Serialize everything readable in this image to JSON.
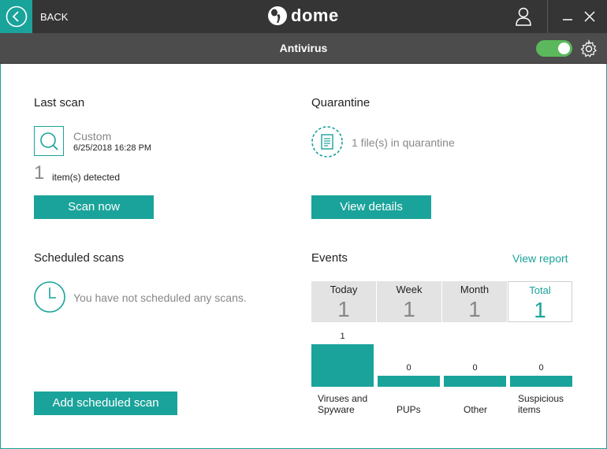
{
  "header": {
    "back_label": "BACK",
    "logo_text": "dome",
    "page_title": "Antivirus"
  },
  "colors": {
    "accent": "#1aa39a",
    "topbar": "#353535",
    "subbar": "#4c4c4c",
    "toggle_on": "#5cb85c"
  },
  "last_scan": {
    "title": "Last scan",
    "type": "Custom",
    "date": "6/25/2018 16:28 PM",
    "detected_count": "1",
    "detected_label": "item(s) detected",
    "button": "Scan now"
  },
  "quarantine": {
    "title": "Quarantine",
    "status": "1 file(s) in quarantine",
    "button": "View details"
  },
  "scheduled": {
    "title": "Scheduled scans",
    "status": "You have not scheduled any scans.",
    "button": "Add scheduled scan"
  },
  "events": {
    "title": "Events",
    "view_report": "View report",
    "tabs": [
      {
        "label": "Today",
        "value": "1"
      },
      {
        "label": "Week",
        "value": "1"
      },
      {
        "label": "Month",
        "value": "1"
      },
      {
        "label": "Total",
        "value": "1"
      }
    ]
  },
  "chart_data": {
    "type": "bar",
    "categories": [
      "Viruses and Spyware",
      "PUPs",
      "Other",
      "Suspicious items"
    ],
    "values": [
      1,
      0,
      0,
      0
    ],
    "value_labels": [
      "1",
      "0",
      "0",
      "0"
    ]
  }
}
